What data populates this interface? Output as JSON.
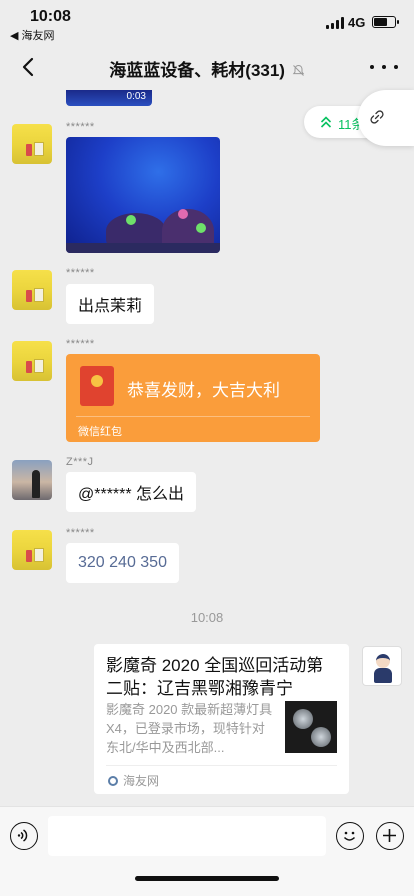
{
  "status": {
    "time": "10:08",
    "back_app": "◀ 海友网",
    "network": "4G",
    "battery_level": 0.6
  },
  "nav": {
    "title": "海蓝蓝设备、耗材(331)",
    "more_icon": "more-icon",
    "mute_icon": "mute-icon"
  },
  "floating": {
    "unread_count": "11条",
    "unread_color": "#07c160"
  },
  "messages": [
    {
      "type": "video",
      "duration": "0:03"
    },
    {
      "sender": "******",
      "type": "image"
    },
    {
      "sender": "******",
      "type": "text",
      "text": "出点茉莉"
    },
    {
      "sender": "******",
      "type": "red_packet",
      "text": "恭喜发财，大吉大利",
      "label": "微信红包"
    },
    {
      "sender": "Z***J",
      "type": "text",
      "text": "@****** 怎么出"
    },
    {
      "sender": "******",
      "type": "text",
      "text": "320 240 350"
    }
  ],
  "timestamp": "10:08",
  "article": {
    "title": "影魔奇 2020 全国巡回活动第二贴：辽吉黑鄂湘豫青宁",
    "desc": "影魔奇 2020 款最新超薄灯具 X4，已登录市场，现特针对东北/华中及西北部...",
    "source": "海友网"
  },
  "input": {
    "placeholder": ""
  },
  "colors": {
    "background": "#ededed",
    "red_packet": "#fa9d3b",
    "link_text": "#576b95"
  }
}
